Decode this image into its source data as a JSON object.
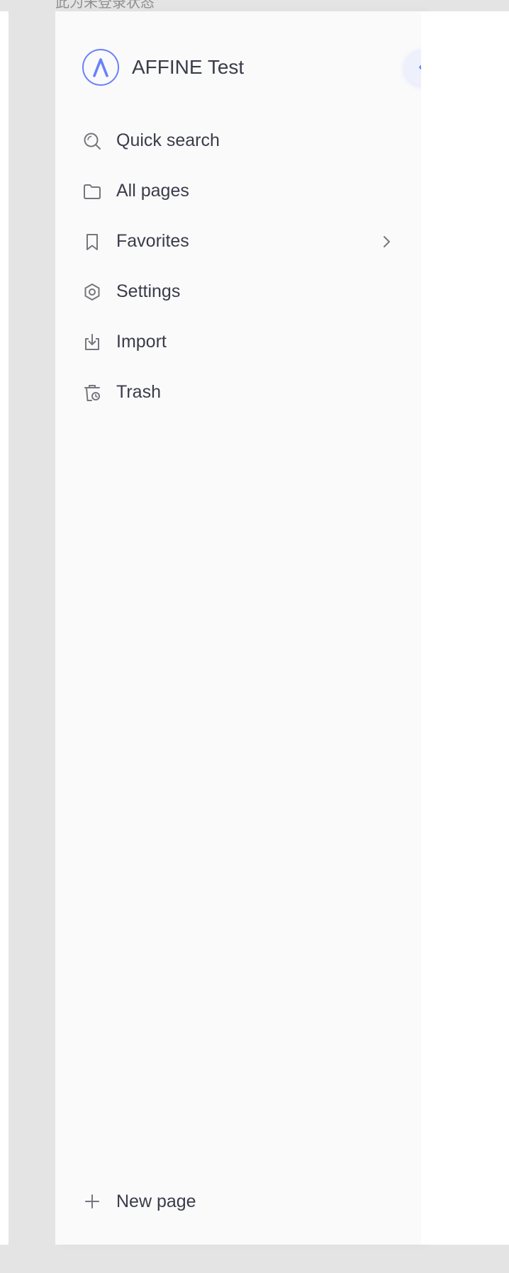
{
  "top_caption": "此为未登录状态",
  "workspace": {
    "name": "AFFINE Test"
  },
  "nav": {
    "items": [
      {
        "label": "Quick search"
      },
      {
        "label": "All pages"
      },
      {
        "label": "Favorites"
      },
      {
        "label": "Settings"
      },
      {
        "label": "Import"
      },
      {
        "label": "Trash"
      }
    ]
  },
  "footer": {
    "new_page_label": "New page"
  },
  "icons": {
    "logo": "affine-logo-icon",
    "collapse": "chevron-left-icon",
    "quick_search": "search-icon",
    "all_pages": "folder-icon",
    "favorites": "bookmark-icon",
    "favorites_expand": "chevron-right-icon",
    "settings": "gear-icon",
    "import": "import-icon",
    "trash": "trash-icon",
    "new_page": "plus-icon"
  },
  "colors": {
    "accent": "#6880ff",
    "text": "#3a3c4a",
    "icon": "#77757d",
    "sidebar_bg": "#fafafa",
    "outer_bg": "#e4e4e4"
  }
}
